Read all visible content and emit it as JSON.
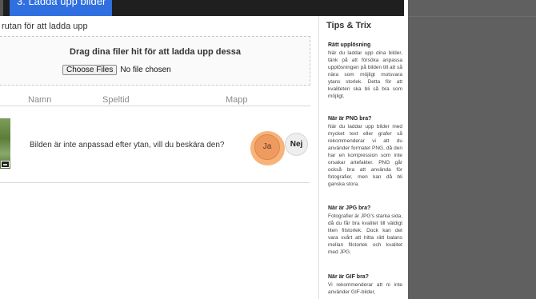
{
  "header": {
    "active_tab": "3. Ladda upp bilder"
  },
  "upload": {
    "instruction": "rutan för att ladda upp",
    "dropzone_title": "Drag dina filer hit för att ladda upp dessa",
    "choose_button": "Choose Files",
    "file_status": "No file chosen"
  },
  "table": {
    "columns": [
      "Namn",
      "Speltid",
      "Mapp"
    ],
    "row": {
      "question": "Bilden är inte anpassad efter ytan, vill du beskära den?",
      "yes_label": "Ja",
      "no_label": "Nej"
    }
  },
  "sidebar": {
    "title": "Tips & Trix",
    "tips": [
      {
        "heading": "Rätt upplösning",
        "body": "När du laddar upp dina bilder, tänk på att försöka anpassa upplösningen på bilden till att så nära som möjligt motsvara ytans storlek. Detta för att kvaliteten ska bli så bra som möjligt."
      },
      {
        "heading": "När är PNG bra?",
        "body": "När du laddar upp bilder med mycket text eller grafer så rekommenderar vi att du använder formatet PNG, då den har en kompression som inte orsakar artefakter. PNG går också bra att använda för fotografier, men kan då bli ganska stora."
      },
      {
        "heading": "När är JPG bra?",
        "body": "Fotografier är JPG's starka sida, då du får bra kvalitet till väldigt liten filstorlek. Dock kan det vara svårt att hitta rätt balans mellan filstorlek och kvalitet med JPG."
      },
      {
        "heading": "När är GIF bra?",
        "body": "Vi rekommenderar att ni inte använder GIF-bilder,"
      }
    ]
  },
  "colors": {
    "topbar": "#1f1f1f",
    "active_tab": "#2f6fe0",
    "yes_button": "#ef9a60",
    "overlay": "#606060"
  }
}
